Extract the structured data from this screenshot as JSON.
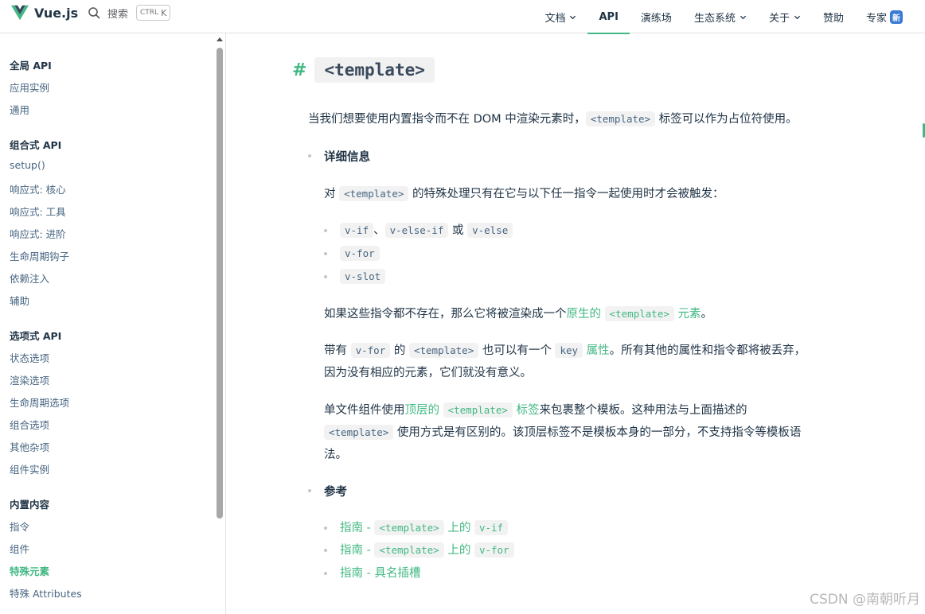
{
  "brand": {
    "name": "Vue.js",
    "color": "#42b883"
  },
  "search": {
    "label": "搜索",
    "kbd_ctrl": "CTRL",
    "kbd_key": "K"
  },
  "nav": {
    "docs": "文档",
    "api": "API",
    "playground": "演练场",
    "ecosystem": "生态系统",
    "about": "关于",
    "sponsor": "赞助",
    "experts": "专家",
    "experts_badge": "新"
  },
  "sidebar": {
    "global_title": "全局 API",
    "global_items": [
      "应用实例",
      "通用"
    ],
    "composition_title": "组合式 API",
    "composition_items": [
      "setup()",
      "响应式: 核心",
      "响应式: 工具",
      "响应式: 进阶",
      "生命周期钩子",
      "依赖注入",
      "辅助"
    ],
    "options_title": "选项式 API",
    "options_items": [
      "状态选项",
      "渲染选项",
      "生命周期选项",
      "组合选项",
      "其他杂项",
      "组件实例"
    ],
    "builtin_title": "内置内容",
    "builtin_items": [
      "指令",
      "组件",
      "特殊元素",
      "特殊 Attributes"
    ]
  },
  "content": {
    "hash": "#",
    "title": "<template>",
    "intro_a": "当我们想要使用内置指令而不在 DOM 中渲染元素时，",
    "intro_code": "<template>",
    "intro_b": " 标签可以作为占位符使用。",
    "details_title": "详细信息",
    "p1_a": "对 ",
    "p1_code": "<template>",
    "p1_b": " 的特殊处理只有在它与以下任一指令一起使用时才会被触发：",
    "li1_code1": "v-if",
    "li1_sep1": "、",
    "li1_code2": "v-else-if",
    "li1_sep2": " 或 ",
    "li1_code3": "v-else",
    "li2_code": "v-for",
    "li3_code": "v-slot",
    "p2_a": "如果这些指令都不存在，那么它将被渲染成一个",
    "p2_link": "原生的",
    "p2_code": "<template>",
    "p2_link2": "元素",
    "p2_b": "。",
    "p3_a": "带有 ",
    "p3_code1": "v-for",
    "p3_b": " 的 ",
    "p3_code2": "<template>",
    "p3_c": " 也可以有一个 ",
    "p3_code3": "key",
    "p3_link": "属性",
    "p3_d": "。所有其他的属性和指令都将被丢弃，",
    "p3_e": "因为没有相应的元素，它们就没有意义。",
    "p4_a": "单文件组件使用",
    "p4_link": "顶层的",
    "p4_code": "<template>",
    "p4_link2": "标签",
    "p4_b": "来包裹整个模板。这种用法与上面描述的",
    "p4_code2": "<template>",
    "p4_c": " 使用方式是有区别的。该顶层标签不是模板本身的一部分，不支持指令等模板语",
    "p4_d": "法。",
    "ref_title": "参考",
    "ref1_a": "指南 - ",
    "ref1_code": "<template>",
    "ref1_b": " 上的 ",
    "ref1_code2": "v-if",
    "ref2_a": "指南 - ",
    "ref2_code": "<template>",
    "ref2_b": " 上的 ",
    "ref2_code2": "v-for",
    "ref3": "指南 - 具名插槽"
  },
  "watermark": "CSDN @南朝听月"
}
